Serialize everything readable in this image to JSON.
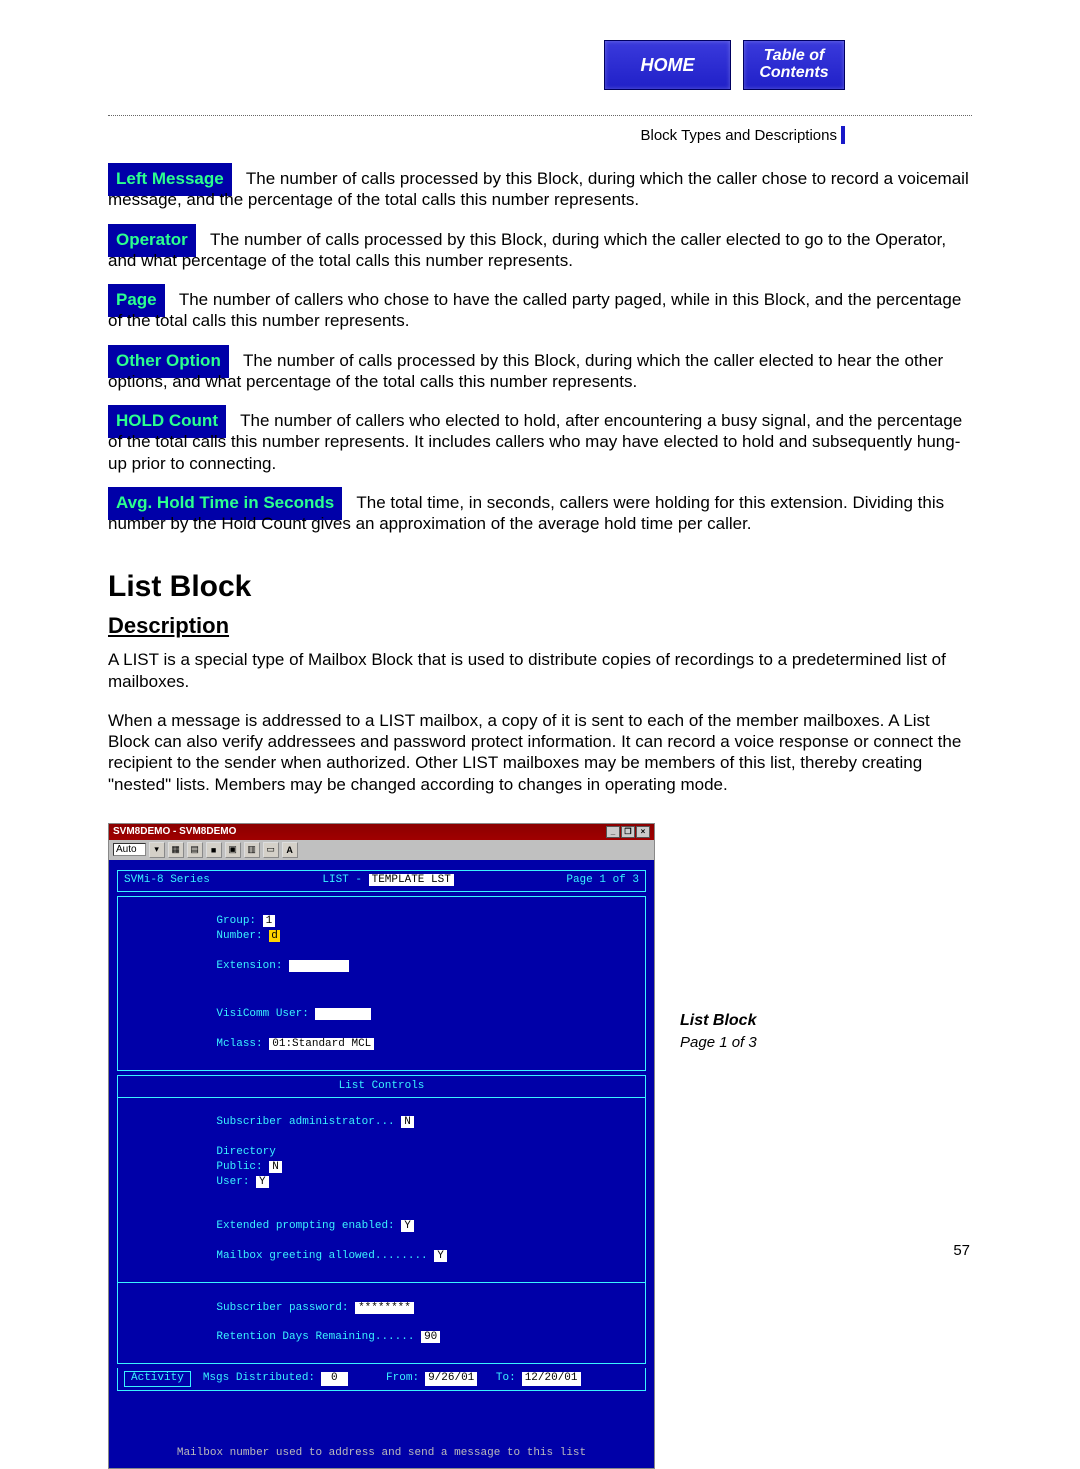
{
  "nav": {
    "home": "HOME",
    "toc": "Table of\nContents"
  },
  "breadcrumb": "Block Types and Descriptions",
  "defs": [
    {
      "term": "Left Message",
      "body": "The number of calls processed by this Block, during which the caller chose to record a voicemail message, and the percentage of the total calls this number represents."
    },
    {
      "term": "Operator",
      "body": "The number of calls processed by this Block, during which the caller elected to go to the Operator, and what percentage of the total calls this number represents."
    },
    {
      "term": "Page",
      "body": "The number of callers who chose to have the called party paged, while in this Block, and the percentage of the total calls this number represents."
    },
    {
      "term": "Other Option",
      "body": "The number of calls processed by this Block, during which the caller elected to hear the other options, and what percentage of the total calls this number represents."
    },
    {
      "term": "HOLD Count",
      "body": "The number of callers who elected to hold, after encountering a busy signal, and the percentage of the total calls this number represents. It includes callers who may have elected to hold and subsequently hung-up prior to connecting."
    },
    {
      "term": "Avg. Hold Time in Seconds",
      "body": "The total time, in seconds, callers were holding for this extension. Dividing this number by the Hold Count gives an approximation of the average hold time per caller."
    }
  ],
  "section": {
    "heading": "List Block",
    "subheading": "Description",
    "p1": "A LIST is a special type of Mailbox Block that is used to distribute copies of recordings to a predetermined list of mailboxes.",
    "p2": "When a message is addressed to a LIST mailbox, a copy of it is sent to each of the member mailboxes. A List Block can also verify addressees and password protect information. It can record a voice response or connect the recipient to the sender when authorized. Other LIST mailboxes may be members of this list, thereby creating \"nested\" lists. Members may be changed according to changes in operating mode."
  },
  "shot": {
    "winTitle": "SVM8DEMO - SVM8DEMO",
    "toolbarLabel": "Auto",
    "series": "SVMi-8 Series",
    "listLabel": "LIST -",
    "listName": "TEMPLATE LST",
    "pageLabel": "Page 1 of 3",
    "group": {
      "label": "Group:",
      "value": "1"
    },
    "number": {
      "label": "Number:",
      "value": "d"
    },
    "extension": {
      "label": "Extension:"
    },
    "visicomm": {
      "label": "VisiComm User:"
    },
    "mclass": {
      "label": "Mclass:",
      "value": "01:Standard MCL"
    },
    "controlsHeader": "List Controls",
    "subAdmin": {
      "label": "Subscriber administrator...",
      "value": "N"
    },
    "extPrompt": {
      "label": "Extended prompting enabled:",
      "value": "Y"
    },
    "dir": {
      "label": "Directory",
      "publicLabel": "Public:",
      "publicValue": "N",
      "userLabel": "User:",
      "userValue": "Y"
    },
    "greeting": {
      "label": "Mailbox greeting allowed........",
      "value": "Y"
    },
    "subPass": {
      "label": "Subscriber password:",
      "value": "********"
    },
    "retention": {
      "label": "Retention Days Remaining......",
      "value": "90"
    },
    "activity": "Activity",
    "msgs": {
      "label": "Msgs Distributed:",
      "value": "0"
    },
    "from": {
      "label": "From:",
      "value": "9/26/01"
    },
    "to": {
      "label": "To:",
      "value": "12/20/01"
    },
    "hint": "Mailbox number used to address and send a message to this list"
  },
  "caption": {
    "title": "List Block",
    "page": "Page 1 of 3"
  },
  "pageNumber": "57"
}
